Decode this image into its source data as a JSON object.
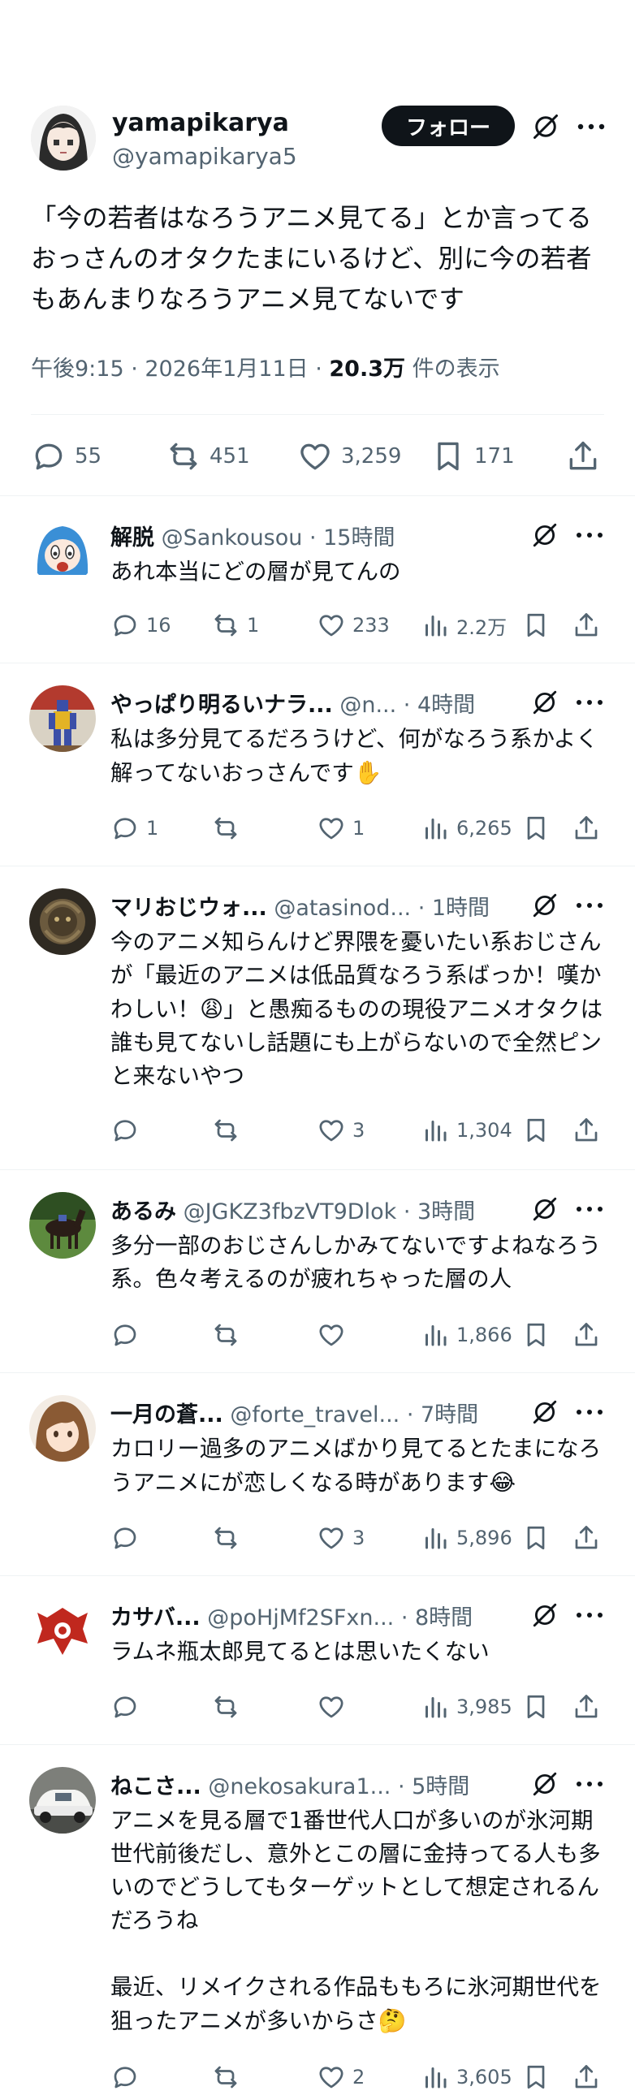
{
  "main": {
    "display_name": "yamapikarya",
    "handle": "@yamapikarya5",
    "follow_label": "フォロー",
    "text": "「今の若者はなろうアニメ見てる」とか言ってるおっさんのオタクたまにいるけど、別に今の若者もあんまりなろうアニメ見てないです",
    "time_date": "午後9:15 · 2026年1月11日 · ",
    "views_count": "20.3万",
    "views_suffix": " 件の表示",
    "replies": "55",
    "reposts": "451",
    "likes": "3,259",
    "bookmarks": "171"
  },
  "replies": [
    {
      "name": "解脱",
      "meta": " @Sankousou · 15時間",
      "text": "あれ本当にどの層が見てんの",
      "replies": "16",
      "reposts": "1",
      "likes": "233",
      "views": "2.2万",
      "avatar": "blue-haired-girl"
    },
    {
      "name": "やっぱり明るいナラ...",
      "meta": " @n... · 4時間",
      "text": "私は多分見てるだろうけど、何がなろう系かよく解ってないおっさんです",
      "emoji": "✋",
      "replies": "1",
      "reposts": "",
      "likes": "1",
      "views": "6,265",
      "avatar": "robot-figure"
    },
    {
      "name": "マリおじウォ...",
      "meta": " @atasinod... · 1時間",
      "text": "今のアニメ知らんけど界隈を憂いたい系おじさんが「最近のアニメは低品質なろう系ばっか！嘆かわしい！",
      "emoji": "😩",
      "text2": "」と愚痴るものの現役アニメオタクは誰も見てないし話題にも上がらないので全然ピンと来ないやつ",
      "replies": "",
      "reposts": "",
      "likes": "3",
      "views": "1,304",
      "avatar": "creature"
    },
    {
      "name": "あるみ",
      "meta": " @JGKZ3fbzVT9Dlok · 3時間",
      "text": "多分一部のおじさんしかみてないですよねなろう系。色々考えるのが疲れちゃった層の人",
      "replies": "",
      "reposts": "",
      "likes": "",
      "views": "1,866",
      "avatar": "horse"
    },
    {
      "name": "一月の蒼...",
      "meta": " @forte_travel... · 7時間",
      "text": "カロリー過多のアニメばかり見てるとたまになろうアニメにが恋しくなる時があります",
      "emoji": "😂",
      "replies": "",
      "reposts": "",
      "likes": "3",
      "views": "5,896",
      "avatar": "anime-boy"
    },
    {
      "name": "カサバ...",
      "meta": " @poHjMf2SFxn... · 8時間",
      "text": "ラムネ瓶太郎見てるとは思いたくない",
      "replies": "",
      "reposts": "",
      "likes": "",
      "views": "3,985",
      "avatar": "red-emblem"
    },
    {
      "name": "ねこさ...",
      "meta": " @nekosakura1... · 5時間",
      "text": "アニメを見る層で1番世代人口が多いのが氷河期世代前後だし、意外とこの層に金持ってる人も多いのでどうしてもターゲットとして想定されるんだろうね\n\n最近、リメイクされる作品ももろに氷河期世代を狙ったアニメが多いからさ",
      "emoji": "🤔",
      "replies": "",
      "reposts": "",
      "likes": "2",
      "views": "3,605",
      "avatar": "white-car"
    }
  ],
  "colors": {
    "text": "#0f1419",
    "secondary": "#536471",
    "divider": "#eff3f4",
    "follow_bg": "#0f1419"
  }
}
